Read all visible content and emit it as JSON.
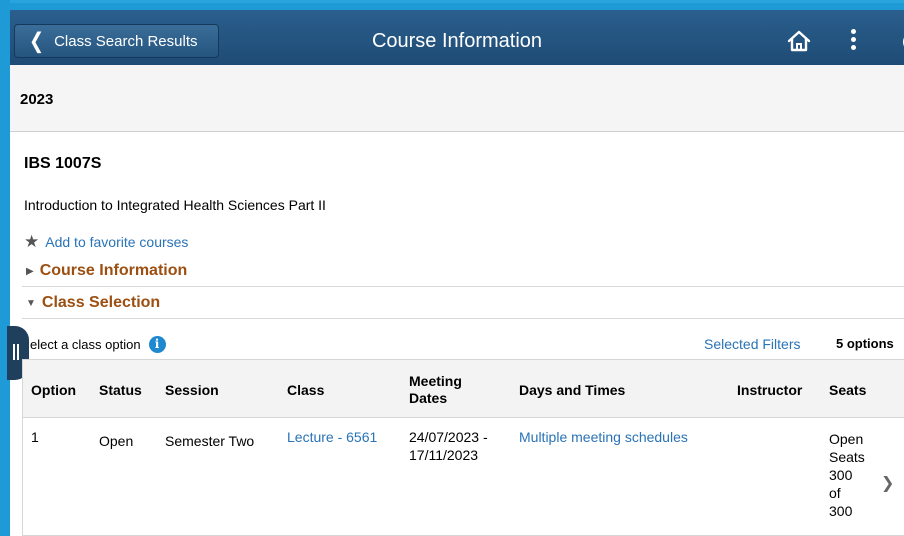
{
  "header": {
    "back_label": "Class Search Results",
    "title": "Course Information",
    "icons": [
      "chevron-left-icon",
      "home-icon",
      "more-vertical-icon"
    ]
  },
  "term": "2023",
  "course": {
    "code": "IBS 1007S",
    "title": "Introduction to Integrated Health Sciences Part II",
    "favorite_label": "Add to favorite courses"
  },
  "sections": {
    "course_information": "Course Information",
    "class_selection": "Class Selection"
  },
  "class_selection": {
    "prompt": "elect a class option",
    "filters_label": "Selected Filters",
    "options_count": "5 options"
  },
  "table": {
    "headers": {
      "option": "Option",
      "status": "Status",
      "session": "Session",
      "class": "Class",
      "meeting_line1": "Meeting",
      "meeting_line2": "Dates",
      "days": "Days and Times",
      "instructor": "Instructor",
      "seats": "Seats"
    },
    "rows": [
      {
        "option": "1",
        "status": "Open",
        "session": "Semester Two",
        "class": "Lecture - 6561",
        "meeting_start": "24/07/2023 -",
        "meeting_end": "17/11/2023",
        "days": "Multiple meeting schedules",
        "instructor": "",
        "seats_lines": [
          "Open",
          "Seats",
          "300",
          "of",
          "300"
        ]
      }
    ]
  },
  "colors": {
    "frame": "#1e9ad6",
    "header": "#25557f",
    "link": "#2a73b6",
    "section": "#9c4f10"
  }
}
